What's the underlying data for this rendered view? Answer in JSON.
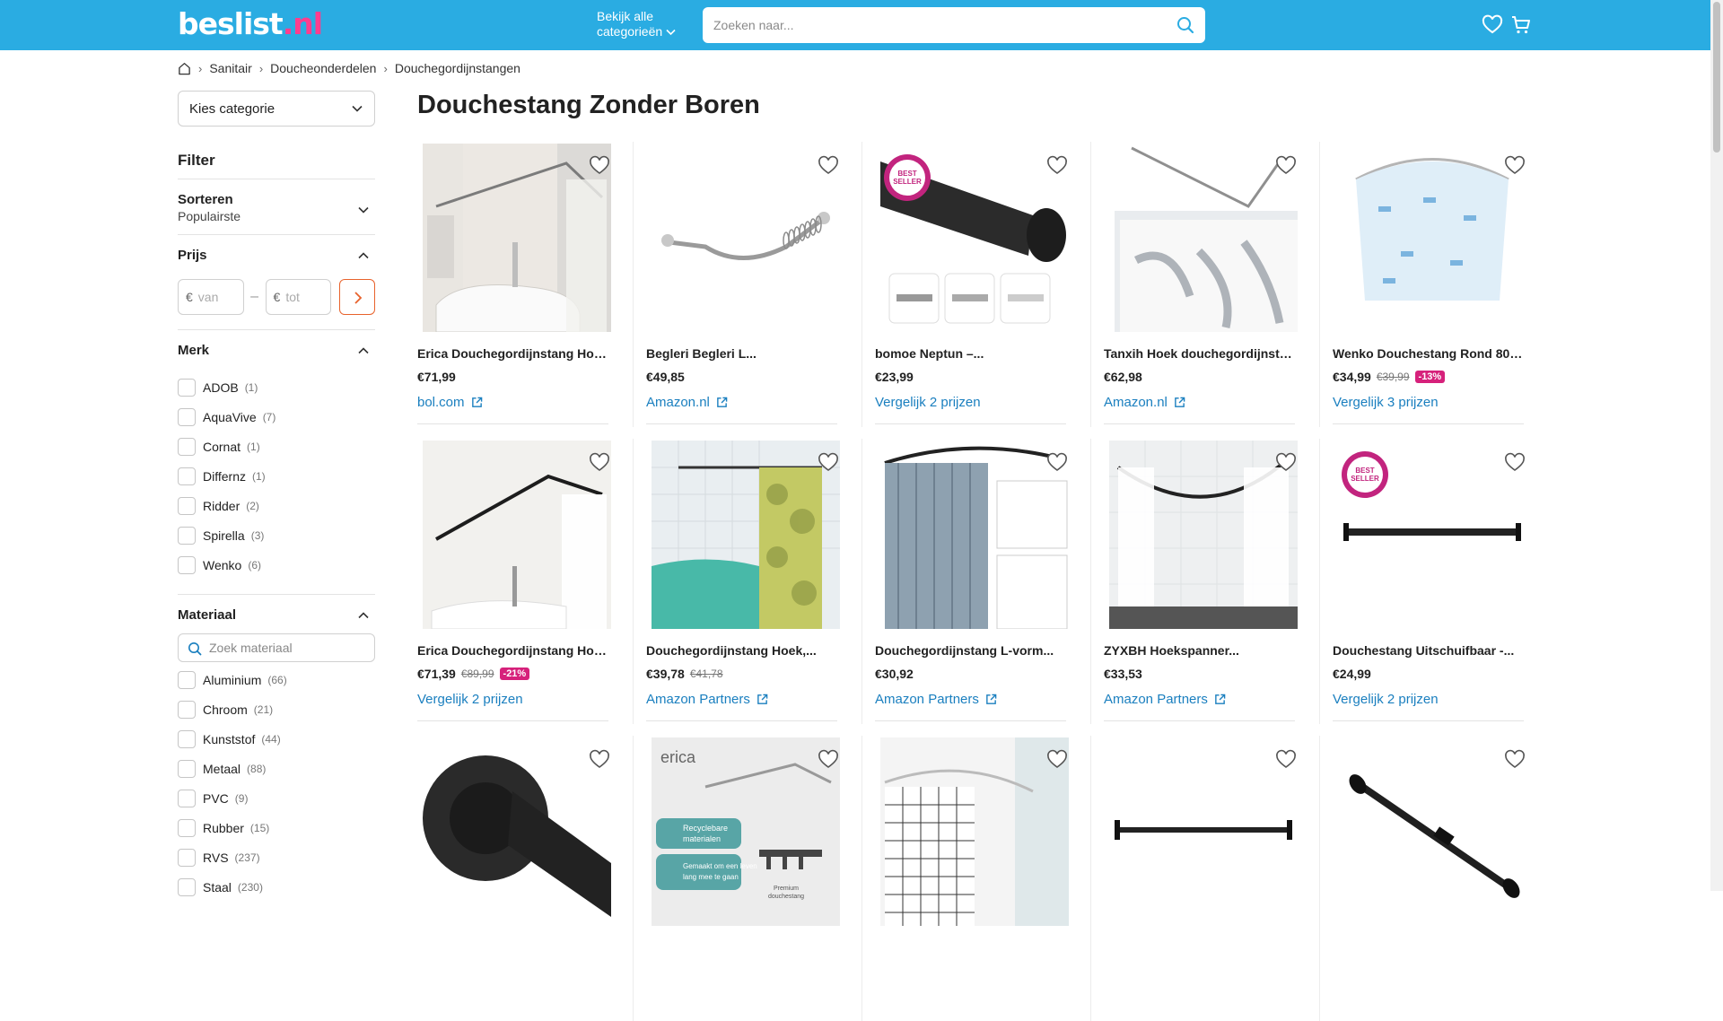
{
  "header": {
    "logo": {
      "main": "beslist",
      "dot": ".",
      "tld": "nl"
    },
    "categories_button": {
      "line1": "Bekijk alle",
      "line2": "categorieën"
    },
    "search_placeholder": "Zoeken naar..."
  },
  "breadcrumb": [
    "Sanitair",
    "Doucheonderdelen",
    "Douchegordijnstangen"
  ],
  "sidebar": {
    "category_select": "Kies categorie",
    "filter_title": "Filter",
    "sort": {
      "label": "Sorteren",
      "value": "Populairste"
    },
    "price": {
      "label": "Prijs",
      "currency": "€",
      "from_placeholder": "van",
      "to_placeholder": "tot",
      "dash": "–"
    },
    "brand": {
      "label": "Merk",
      "items": [
        {
          "name": "ADOB",
          "count": "(1)"
        },
        {
          "name": "AquaVive",
          "count": "(7)"
        },
        {
          "name": "Cornat",
          "count": "(1)"
        },
        {
          "name": "Differnz",
          "count": "(1)"
        },
        {
          "name": "Ridder",
          "count": "(2)"
        },
        {
          "name": "Spirella",
          "count": "(3)"
        },
        {
          "name": "Wenko",
          "count": "(6)"
        }
      ]
    },
    "material": {
      "label": "Materiaal",
      "search_placeholder": "Zoek materiaal",
      "items": [
        {
          "name": "Aluminium",
          "count": "(66)"
        },
        {
          "name": "Chroom",
          "count": "(21)"
        },
        {
          "name": "Kunststof",
          "count": "(44)"
        },
        {
          "name": "Metaal",
          "count": "(88)"
        },
        {
          "name": "PVC",
          "count": "(9)"
        },
        {
          "name": "Rubber",
          "count": "(15)"
        },
        {
          "name": "RVS",
          "count": "(237)"
        },
        {
          "name": "Staal",
          "count": "(230)"
        }
      ]
    }
  },
  "page_title": "Douchestang Zonder Boren",
  "products": [
    {
      "title": "Erica Douchegordijnstang Hoek...",
      "price": "€71,99",
      "old_price": "",
      "discount": "",
      "link": "bol.com",
      "external": true,
      "image": "shower-rod-bathtub-photo"
    },
    {
      "title": "Begleri Begleri L...",
      "price": "€49,85",
      "old_price": "",
      "discount": "",
      "link": "Amazon.nl",
      "external": true,
      "image": "curved-rod-with-rings"
    },
    {
      "title": "bomoe Neptun –...",
      "price": "€23,99",
      "old_price": "",
      "discount": "",
      "link": "Vergelijk 2 prijzen",
      "external": false,
      "image": "black-tension-rod-best-seller",
      "badge": "BEST SELLER 2023"
    },
    {
      "title": "Tanxih Hoek douchegordijnstan...",
      "price": "€62,98",
      "old_price": "",
      "discount": "",
      "link": "Amazon.nl",
      "external": true,
      "image": "l-rod-marble-curtain"
    },
    {
      "title": "Wenko Douchestang Rond 80 X 8...",
      "price": "€34,99",
      "old_price": "€39,99",
      "discount": "-13%",
      "link": "Vergelijk 3 prijzen",
      "external": false,
      "image": "round-rod-blue-curtain"
    },
    {
      "title": "Erica Douchegordijnstang Hoek...",
      "price": "€71,39",
      "old_price": "€89,99",
      "discount": "-21%",
      "link": "Vergelijk 2 prijzen",
      "external": false,
      "image": "black-l-rod-bathtub"
    },
    {
      "title": "Douchegordijnstang Hoek,...",
      "price": "€39,78",
      "old_price": "€41,78",
      "discount": "",
      "link": "Amazon Partners",
      "external": true,
      "image": "rod-teal-tub-curtain"
    },
    {
      "title": "Douchegordijnstang L-vorm...",
      "price": "€30,92",
      "old_price": "",
      "discount": "",
      "link": "Amazon Partners",
      "external": true,
      "image": "l-rod-grey-curtain"
    },
    {
      "title": "ZYXBH Hoekspanner...",
      "price": "€33,53",
      "old_price": "",
      "discount": "",
      "link": "Amazon Partners",
      "external": true,
      "image": "corner-rod-shower"
    },
    {
      "title": "Douchestang Uitschuifbaar -...",
      "price": "€24,99",
      "old_price": "",
      "discount": "",
      "link": "Vergelijk 2 prijzen",
      "external": false,
      "image": "black-straight-rod-best-seller",
      "badge": "BEST SELLER 2023"
    },
    {
      "title": "",
      "price": "",
      "old_price": "",
      "discount": "",
      "link": "",
      "external": false,
      "image": "black-rod-closeup-wet"
    },
    {
      "title": "",
      "price": "",
      "old_price": "",
      "discount": "",
      "link": "",
      "external": false,
      "image": "erica-recyclable-rod",
      "brand_text": "erica",
      "bullets": [
        "Recyclebare materialen",
        "Gemaakt om een leven lang mee te gaan"
      ],
      "caption": "Premium douchestang"
    },
    {
      "title": "",
      "price": "",
      "old_price": "",
      "discount": "",
      "link": "",
      "external": false,
      "image": "curved-rod-checkered-curtain"
    },
    {
      "title": "",
      "price": "",
      "old_price": "",
      "discount": "",
      "link": "",
      "external": false,
      "image": "black-straight-rod"
    },
    {
      "title": "",
      "price": "",
      "old_price": "",
      "discount": "",
      "link": "",
      "external": false,
      "image": "black-diagonal-rod"
    }
  ],
  "colors": {
    "header": "#2aace2",
    "logo_accent": "#ff3d8e",
    "link": "#1a7fbf",
    "discount": "#d6217b",
    "go_button": "#e8622c"
  }
}
